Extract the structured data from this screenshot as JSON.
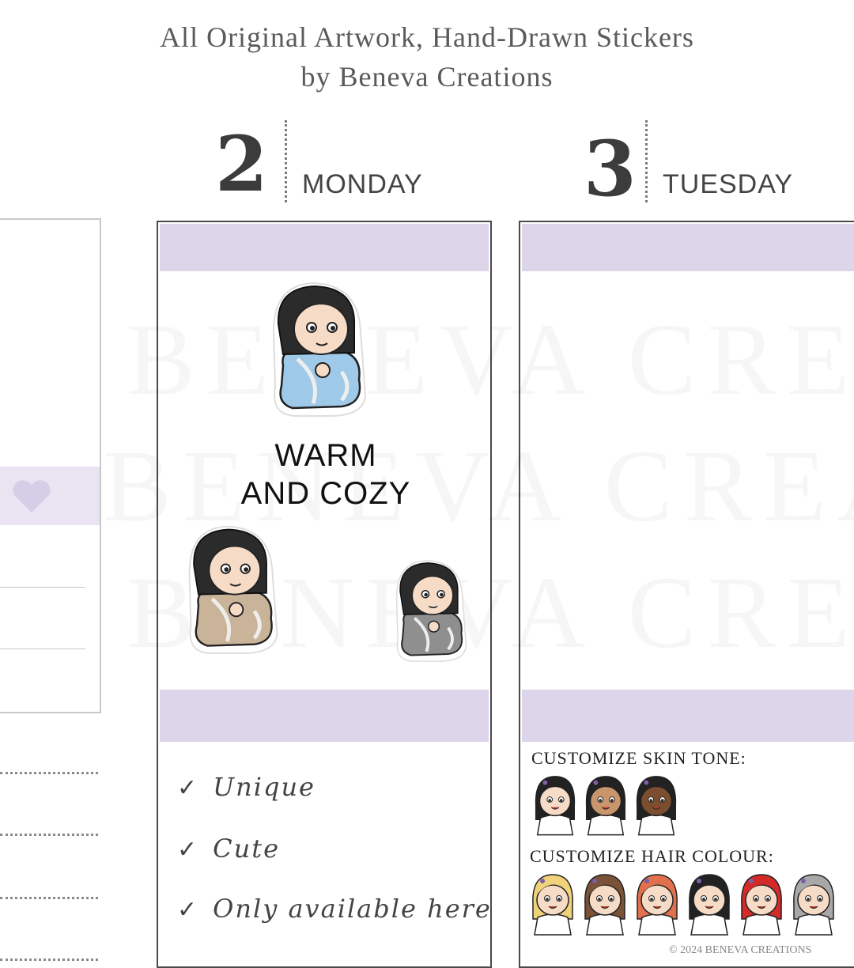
{
  "header": {
    "line1": "All Original Artwork, Hand-Drawn Stickers",
    "line2": "by Beneva Creations"
  },
  "days": [
    {
      "number": "2",
      "name": "MONDAY"
    },
    {
      "number": "3",
      "name": "TUESDAY"
    }
  ],
  "watermark": "BENEVA CREATIONS",
  "stickers": {
    "text_line1": "WARM",
    "text_line2": "AND COZY",
    "characters": [
      {
        "blanket_color": "#9fc9e8",
        "hair_color": "#2b2b2b"
      },
      {
        "blanket_color": "#c9b49a",
        "hair_color": "#2b2b2b"
      },
      {
        "blanket_color": "#8f8f8f",
        "hair_color": "#2b2b2b"
      }
    ]
  },
  "features": {
    "check_icon": "checkmark-icon",
    "items": [
      "Unique",
      "Cute",
      "Only available here"
    ]
  },
  "customize": {
    "skin_label": "CUSTOMIZE SKIN TONE:",
    "skin_tones": [
      "#f6dcc6",
      "#c9956c",
      "#7a4e2e"
    ],
    "hair_label": "CUSTOMIZE HAIR COLOUR:",
    "hair_colours": [
      "#f0d27a",
      "#7a5238",
      "#e0714c",
      "#222222",
      "#d42a2a",
      "#a8a8a8"
    ]
  },
  "heart_icon": "heart-icon",
  "copyright": "© 2024 BENEVA CREATIONS",
  "colors": {
    "band": "#ddd5ea",
    "border": "#4a4a4a"
  }
}
